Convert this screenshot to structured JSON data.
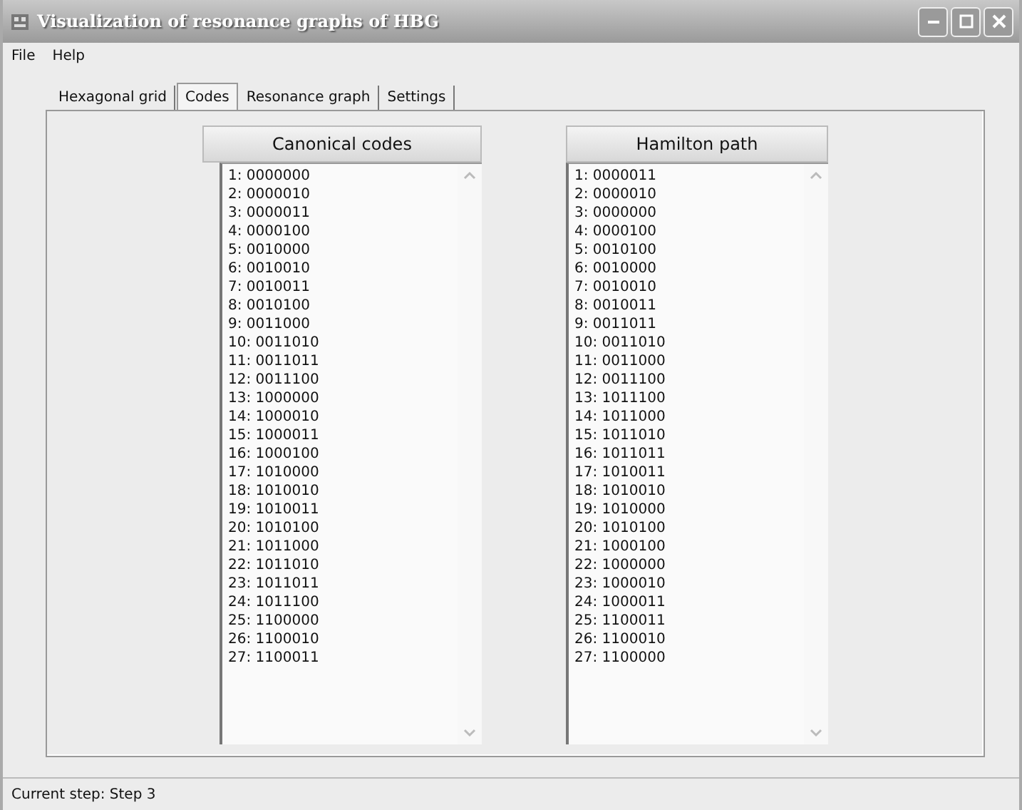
{
  "window": {
    "title": "Visualization of resonance graphs of HBG"
  },
  "menu": [
    "File",
    "Help"
  ],
  "tabs": [
    {
      "label": "Hexagonal grid",
      "selected": false
    },
    {
      "label": "Codes",
      "selected": true
    },
    {
      "label": "Resonance graph",
      "selected": false
    },
    {
      "label": "Settings",
      "selected": false
    }
  ],
  "lists": [
    {
      "title": "Canonical codes",
      "items": [
        "1: 0000000",
        "2: 0000010",
        "3: 0000011",
        "4: 0000100",
        "5: 0010000",
        "6: 0010010",
        "7: 0010011",
        "8: 0010100",
        "9: 0011000",
        "10: 0011010",
        "11: 0011011",
        "12: 0011100",
        "13: 1000000",
        "14: 1000010",
        "15: 1000011",
        "16: 1000100",
        "17: 1010000",
        "18: 1010010",
        "19: 1010011",
        "20: 1010100",
        "21: 1011000",
        "22: 1011010",
        "23: 1011011",
        "24: 1011100",
        "25: 1100000",
        "26: 1100010",
        "27: 1100011"
      ]
    },
    {
      "title": "Hamilton path",
      "items": [
        "1: 0000011",
        "2: 0000010",
        "3: 0000000",
        "4: 0000100",
        "5: 0010100",
        "6: 0010000",
        "7: 0010010",
        "8: 0010011",
        "9: 0011011",
        "10: 0011010",
        "11: 0011000",
        "12: 0011100",
        "13: 1011100",
        "14: 1011000",
        "15: 1011010",
        "16: 1011011",
        "17: 1010011",
        "18: 1010010",
        "19: 1010000",
        "20: 1010100",
        "21: 1000100",
        "22: 1000000",
        "23: 1000010",
        "24: 1000011",
        "25: 1100011",
        "26: 1100010",
        "27: 1100000"
      ]
    }
  ],
  "status_bar": "Current step: Step 3"
}
